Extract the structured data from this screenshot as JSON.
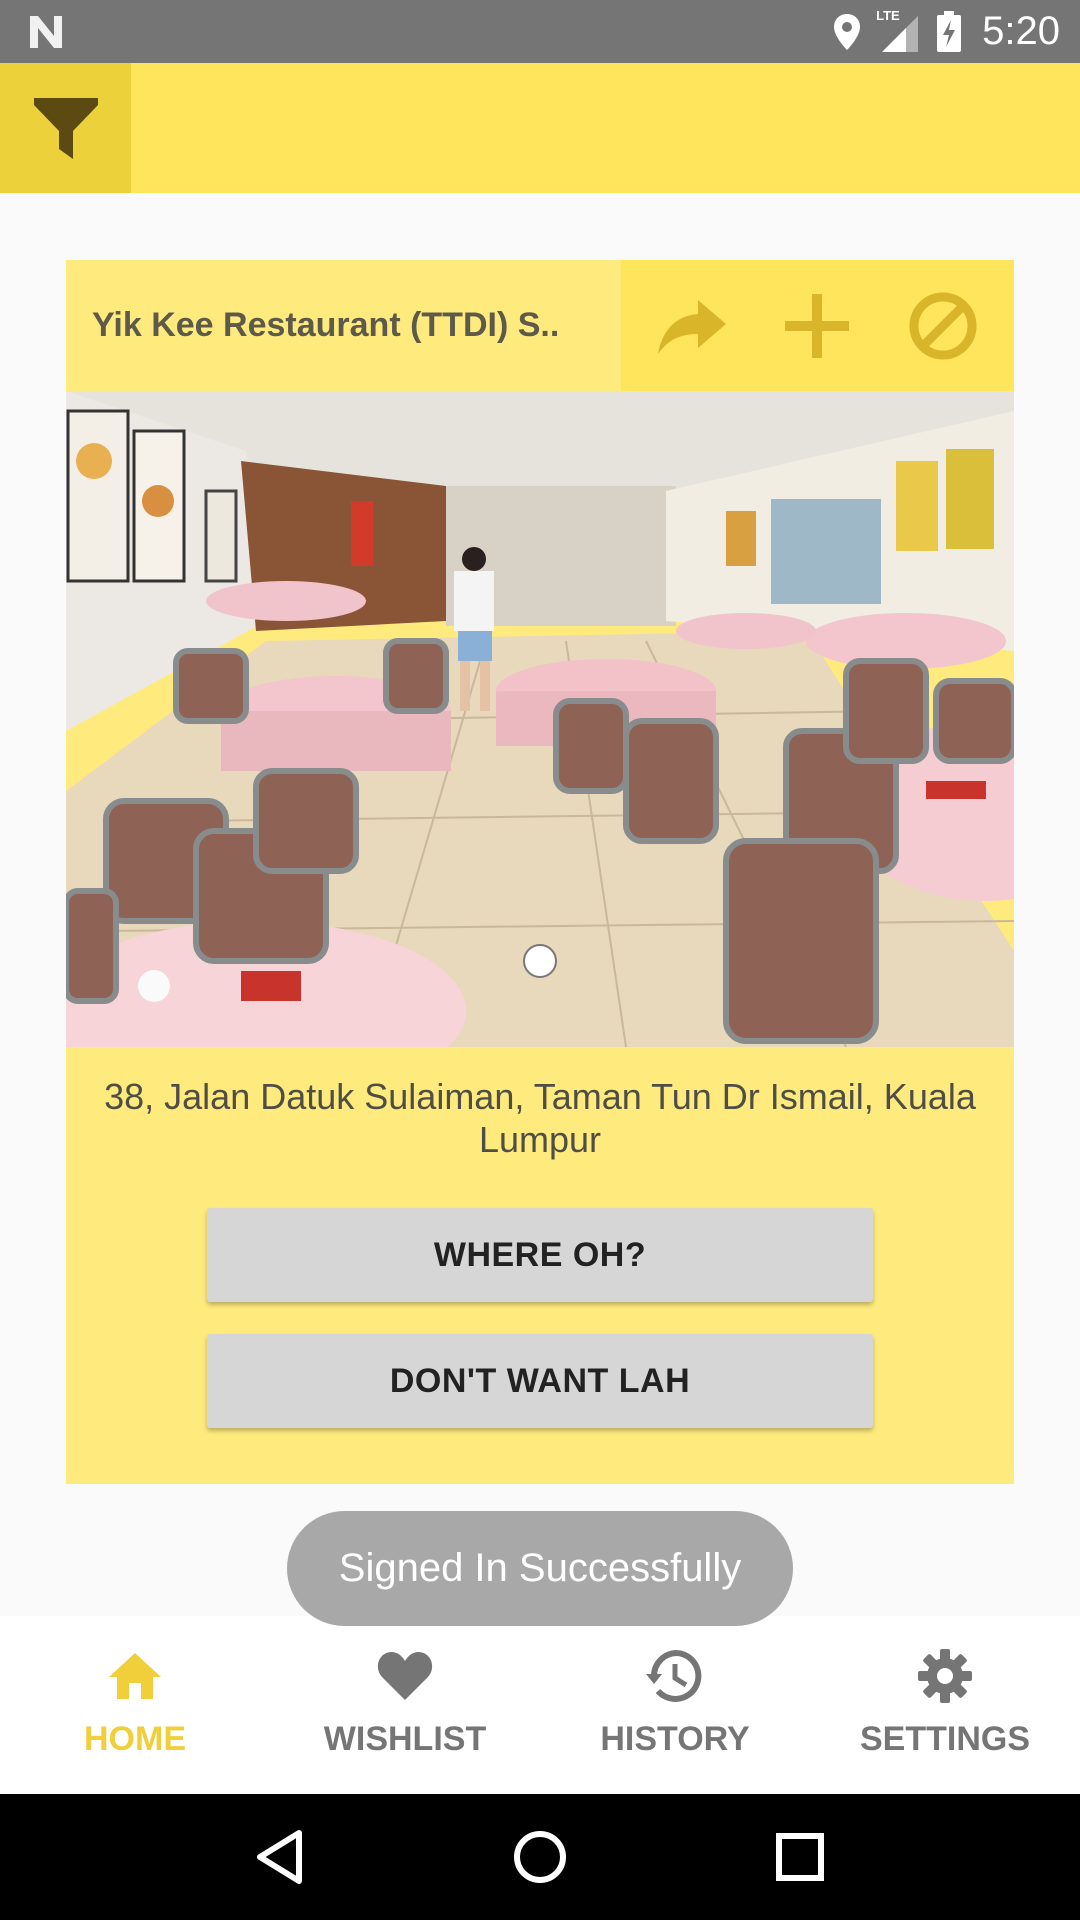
{
  "status_bar": {
    "time": "5:20",
    "network_label": "LTE",
    "icons": [
      "n-logo-icon",
      "location-icon",
      "lte-signal-icon",
      "battery-charging-icon"
    ]
  },
  "app_bar": {
    "filter_icon": "filter-icon"
  },
  "card": {
    "title": "Yik Kee Restaurant (TTDI) S..",
    "actions": [
      "share-icon",
      "add-icon",
      "block-icon"
    ],
    "address": "38, Jalan Datuk Sulaiman, Taman Tun Dr Ismail, Kuala Lumpur",
    "where_button": "WHERE OH?",
    "dont_button": "DON'T WANT LAH"
  },
  "toast": {
    "message": "Signed In Successfully"
  },
  "bottom_nav": {
    "items": [
      {
        "label": "HOME",
        "icon": "home-icon",
        "active": true
      },
      {
        "label": "WISHLIST",
        "icon": "heart-icon",
        "active": false
      },
      {
        "label": "HISTORY",
        "icon": "history-icon",
        "active": false
      },
      {
        "label": "SETTINGS",
        "icon": "gear-icon",
        "active": false
      }
    ]
  },
  "system_nav": {
    "icons": [
      "back-icon",
      "home-circle-icon",
      "recents-icon"
    ]
  },
  "colors": {
    "accent": "#ffe55c",
    "accent_dark": "#ecd13a",
    "card_bg": "#ffea7d",
    "icon_gold": "#d9b52a",
    "active_nav": "#f0cf3a"
  }
}
